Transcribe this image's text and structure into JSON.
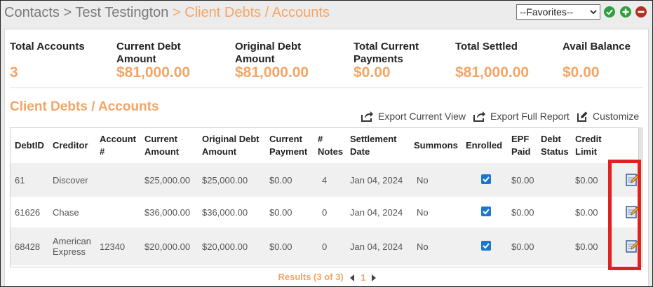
{
  "header": {
    "breadcrumb": {
      "contacts": "Contacts",
      "sep1": " > ",
      "contact_name": "Test Testington",
      "sep2": " > ",
      "current": "Client Debts / Accounts"
    },
    "favorites_select": "--Favorites--"
  },
  "summary": [
    {
      "label": "Total Accounts",
      "value": "3"
    },
    {
      "label": "Current Debt Amount",
      "value": "$81,000.00"
    },
    {
      "label": "Original Debt Amount",
      "value": "$81,000.00"
    },
    {
      "label": "Total Current Payments",
      "value": "$0.00"
    },
    {
      "label": "Total Settled",
      "value": "$81,000.00"
    },
    {
      "label": "Avail Balance",
      "value": "$0.00"
    }
  ],
  "section_title": "Client Debts / Accounts",
  "toolbar": {
    "export_current": "Export Current View",
    "export_full": "Export Full Report",
    "customize": "Customize"
  },
  "table": {
    "columns": [
      "DebtID",
      "Creditor",
      "Account #",
      "Current Amount",
      "Original Debt Amount",
      "Current Payment",
      "# Notes",
      "Settlement Date",
      "Summons",
      "Enrolled",
      "EPF Paid",
      "Debt Status",
      "Credit Limit",
      ""
    ],
    "rows": [
      {
        "debt_id": "61",
        "creditor": "Discover",
        "account": "",
        "current_amount": "$25,000.00",
        "original_amount": "$25,000.00",
        "current_payment": "$0.00",
        "notes": "4",
        "settlement_date": "Jan 04, 2024",
        "summons": "No",
        "enrolled": true,
        "epf_paid": "$0.00",
        "debt_status": "",
        "credit_limit": "$0.00"
      },
      {
        "debt_id": "61626",
        "creditor": "Chase",
        "account": "",
        "current_amount": "$36,000.00",
        "original_amount": "$36,000.00",
        "current_payment": "$0.00",
        "notes": "0",
        "settlement_date": "Jan 04, 2024",
        "summons": "No",
        "enrolled": true,
        "epf_paid": "$0.00",
        "debt_status": "",
        "credit_limit": "$0.00"
      },
      {
        "debt_id": "68428",
        "creditor": "American Express",
        "account": "12340",
        "current_amount": "$20,000.00",
        "original_amount": "$20,000.00",
        "current_payment": "$0.00",
        "notes": "0",
        "settlement_date": "Jan 04, 2024",
        "summons": "No",
        "enrolled": true,
        "epf_paid": "$0.00",
        "debt_status": "",
        "credit_limit": "$0.00"
      }
    ]
  },
  "pagination": {
    "results": "Results (3 of 3)",
    "page": "1"
  },
  "colors": {
    "accent_orange": "#f4a565",
    "highlight_red": "#e32020",
    "checkbox_blue": "#1976d2"
  },
  "icons": [
    "chevron-down-icon",
    "check-circle-icon",
    "add-circle-icon",
    "remove-circle-icon",
    "export-icon",
    "customize-icon",
    "edit-icon",
    "prev-page-icon",
    "next-page-icon"
  ]
}
